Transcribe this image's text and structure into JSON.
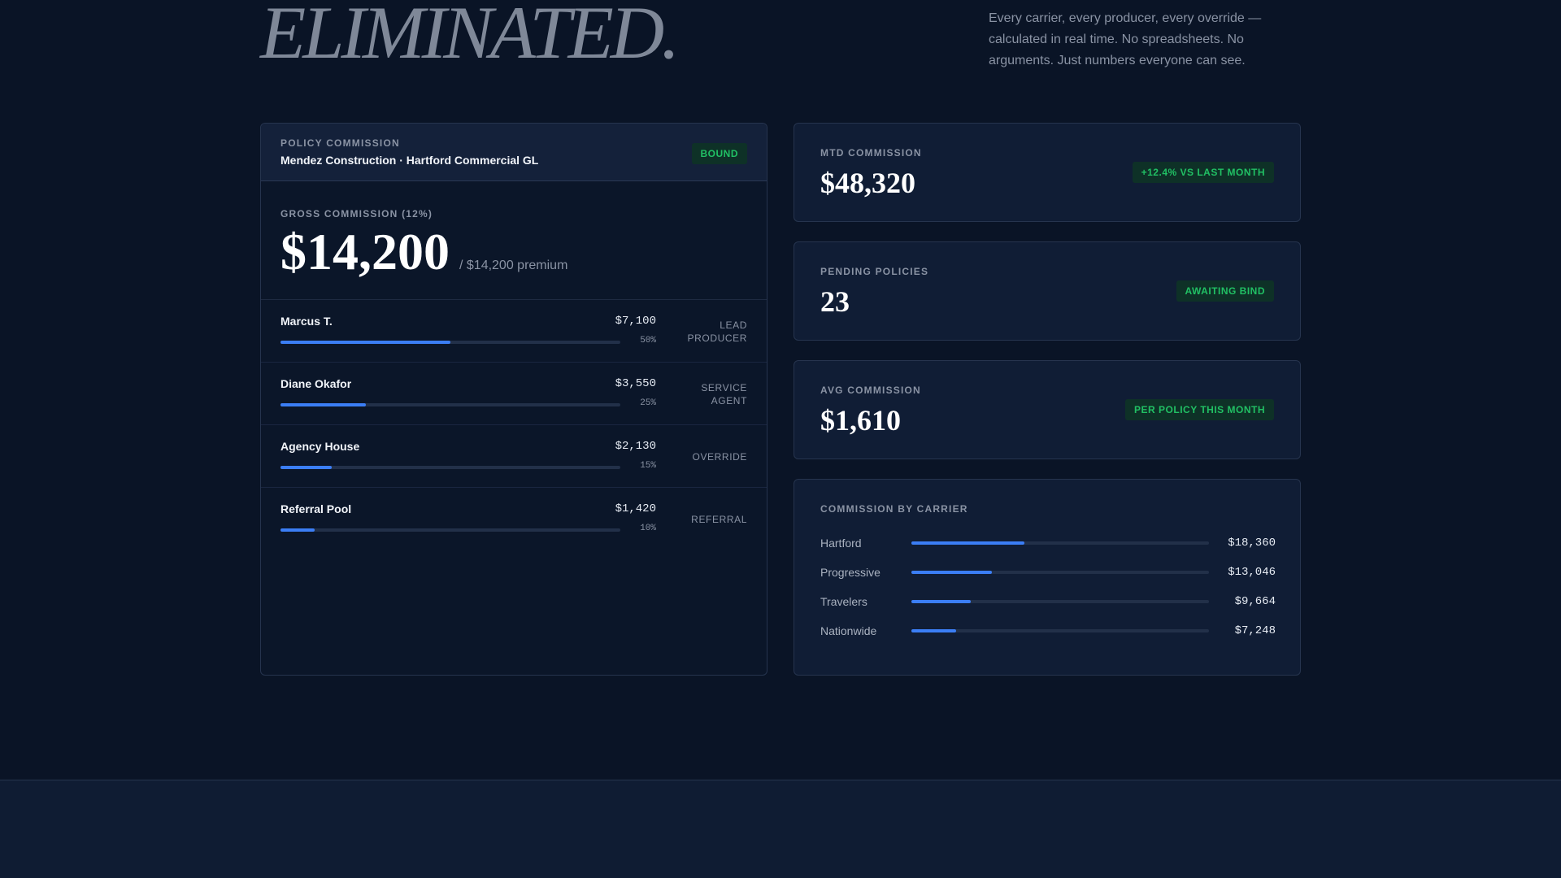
{
  "hero": {
    "title": "ELIMINATED.",
    "description": "Every carrier, every producer, every override — calculated in real time. No spreadsheets. No arguments. Just numbers everyone can see."
  },
  "policy": {
    "eyebrow": "POLICY COMMISSION",
    "subtitle": "Mendez Construction · Hartford Commercial GL",
    "status": "BOUND",
    "gross_label": "GROSS COMMISSION (12%)",
    "gross_value": "$14,200",
    "premium": "/ $14,200 premium",
    "splits": [
      {
        "name": "Marcus T.",
        "amount": "$7,100",
        "percent_label": "50%",
        "percent": 50,
        "role": "LEAD PRODUCER"
      },
      {
        "name": "Diane Okafor",
        "amount": "$3,550",
        "percent_label": "25%",
        "percent": 25,
        "role": "SERVICE AGENT"
      },
      {
        "name": "Agency House",
        "amount": "$2,130",
        "percent_label": "15%",
        "percent": 15,
        "role": "OVERRIDE"
      },
      {
        "name": "Referral Pool",
        "amount": "$1,420",
        "percent_label": "10%",
        "percent": 10,
        "role": "REFERRAL"
      }
    ]
  },
  "stats": [
    {
      "label": "MTD COMMISSION",
      "value": "$48,320",
      "badge": "+12.4% VS LAST MONTH"
    },
    {
      "label": "PENDING POLICIES",
      "value": "23",
      "badge": "AWAITING BIND"
    },
    {
      "label": "AVG COMMISSION",
      "value": "$1,610",
      "badge": "PER POLICY THIS MONTH"
    }
  ],
  "carriers": {
    "title": "COMMISSION BY CARRIER",
    "items": [
      {
        "name": "Hartford",
        "amount": "$18,360",
        "share": 0.38
      },
      {
        "name": "Progressive",
        "amount": "$13,046",
        "share": 0.27
      },
      {
        "name": "Travelers",
        "amount": "$9,664",
        "share": 0.2
      },
      {
        "name": "Nationwide",
        "amount": "$7,248",
        "share": 0.15
      }
    ]
  },
  "colors": {
    "accent": "#3b7ef5",
    "success": "#21c064",
    "background": "#0a1426"
  }
}
